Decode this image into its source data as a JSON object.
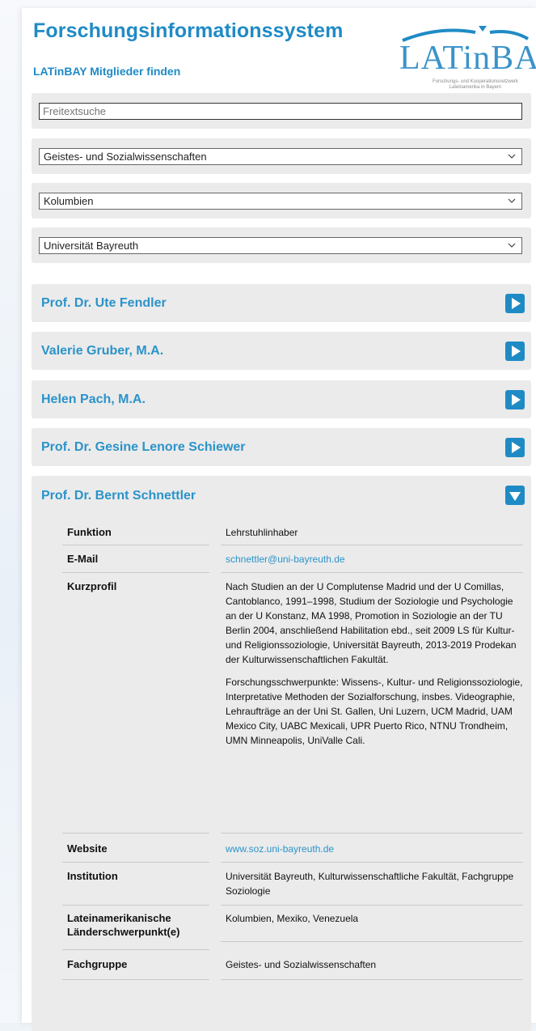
{
  "header": {
    "title": "Forschungsinformationssystem",
    "subtitle": "LATinBAY Mitglieder finden",
    "logo_text": "LATinBAY",
    "logo_tagline": "Forschungs- und Kooperationsnetzwerk Lateinamerika in Bayern"
  },
  "filters": {
    "search_placeholder": "Freitextsuche",
    "search_value": "",
    "discipline": "Geistes- und Sozialwissenschaften",
    "country": "Kolumbien",
    "institution": "Universität Bayreuth"
  },
  "people": [
    {
      "name": "Prof. Dr. Ute Fendler",
      "state": "collapsed"
    },
    {
      "name": "Valerie Gruber, M.A.",
      "state": "collapsed"
    },
    {
      "name": "Helen Pach, M.A.",
      "state": "collapsed"
    },
    {
      "name": "Prof. Dr. Gesine Lenore Schiewer",
      "state": "collapsed"
    },
    {
      "name": "Prof. Dr. Bernt Schnettler",
      "state": "expanded"
    }
  ],
  "details": {
    "funktion_label": "Funktion",
    "funktion_value": "Lehrstuhlinhaber",
    "email_label": "E-Mail",
    "email_value": "schnettler@uni-bayreuth.de",
    "kurzprofil_label": "Kurzprofil",
    "kurzprofil_p1": "Nach Studien an der U Complutense Madrid und der U Comillas, Cantoblanco, 1991–1998, Studium der Soziologie und Psychologie an der U Konstanz, MA 1998, Promotion in Soziologie an der TU Berlin 2004, anschließend Habilitation ebd., seit 2009 LS für Kultur- und Religionssoziologie, Universität Bayreuth, 2013-2019 Prodekan der Kulturwissenschaftlichen Fakultät.",
    "kurzprofil_p2": "Forschungsschwerpunkte: Wissens-, Kultur- und Religionssoziologie, Interpretative Methoden der Sozialforschung, insbes. Videographie, Lehraufträge an der Uni St. Gallen, Uni Luzern, UCM Madrid, UAM Mexico City, UABC Mexicali, UPR Puerto Rico, NTNU Trondheim, UMN Minneapolis, UniValle Cali.",
    "website_label": "Website",
    "website_value": "www.soz.uni-bayreuth.de",
    "institution_label": "Institution",
    "institution_value": "Universität Bayreuth, Kulturwissenschaftliche Fakultät, Fachgruppe Soziologie",
    "laender_label": "Lateinamerikanische Länderschwerpunkt(e)",
    "laender_value": "Kolumbien, Mexiko, Venezuela",
    "fachgruppe_label": "Fachgruppe",
    "fachgruppe_value": "Geistes- und Sozialwissenschaften"
  },
  "colors": {
    "accent": "#1f8bc5",
    "box_bg": "#ebebeb"
  }
}
